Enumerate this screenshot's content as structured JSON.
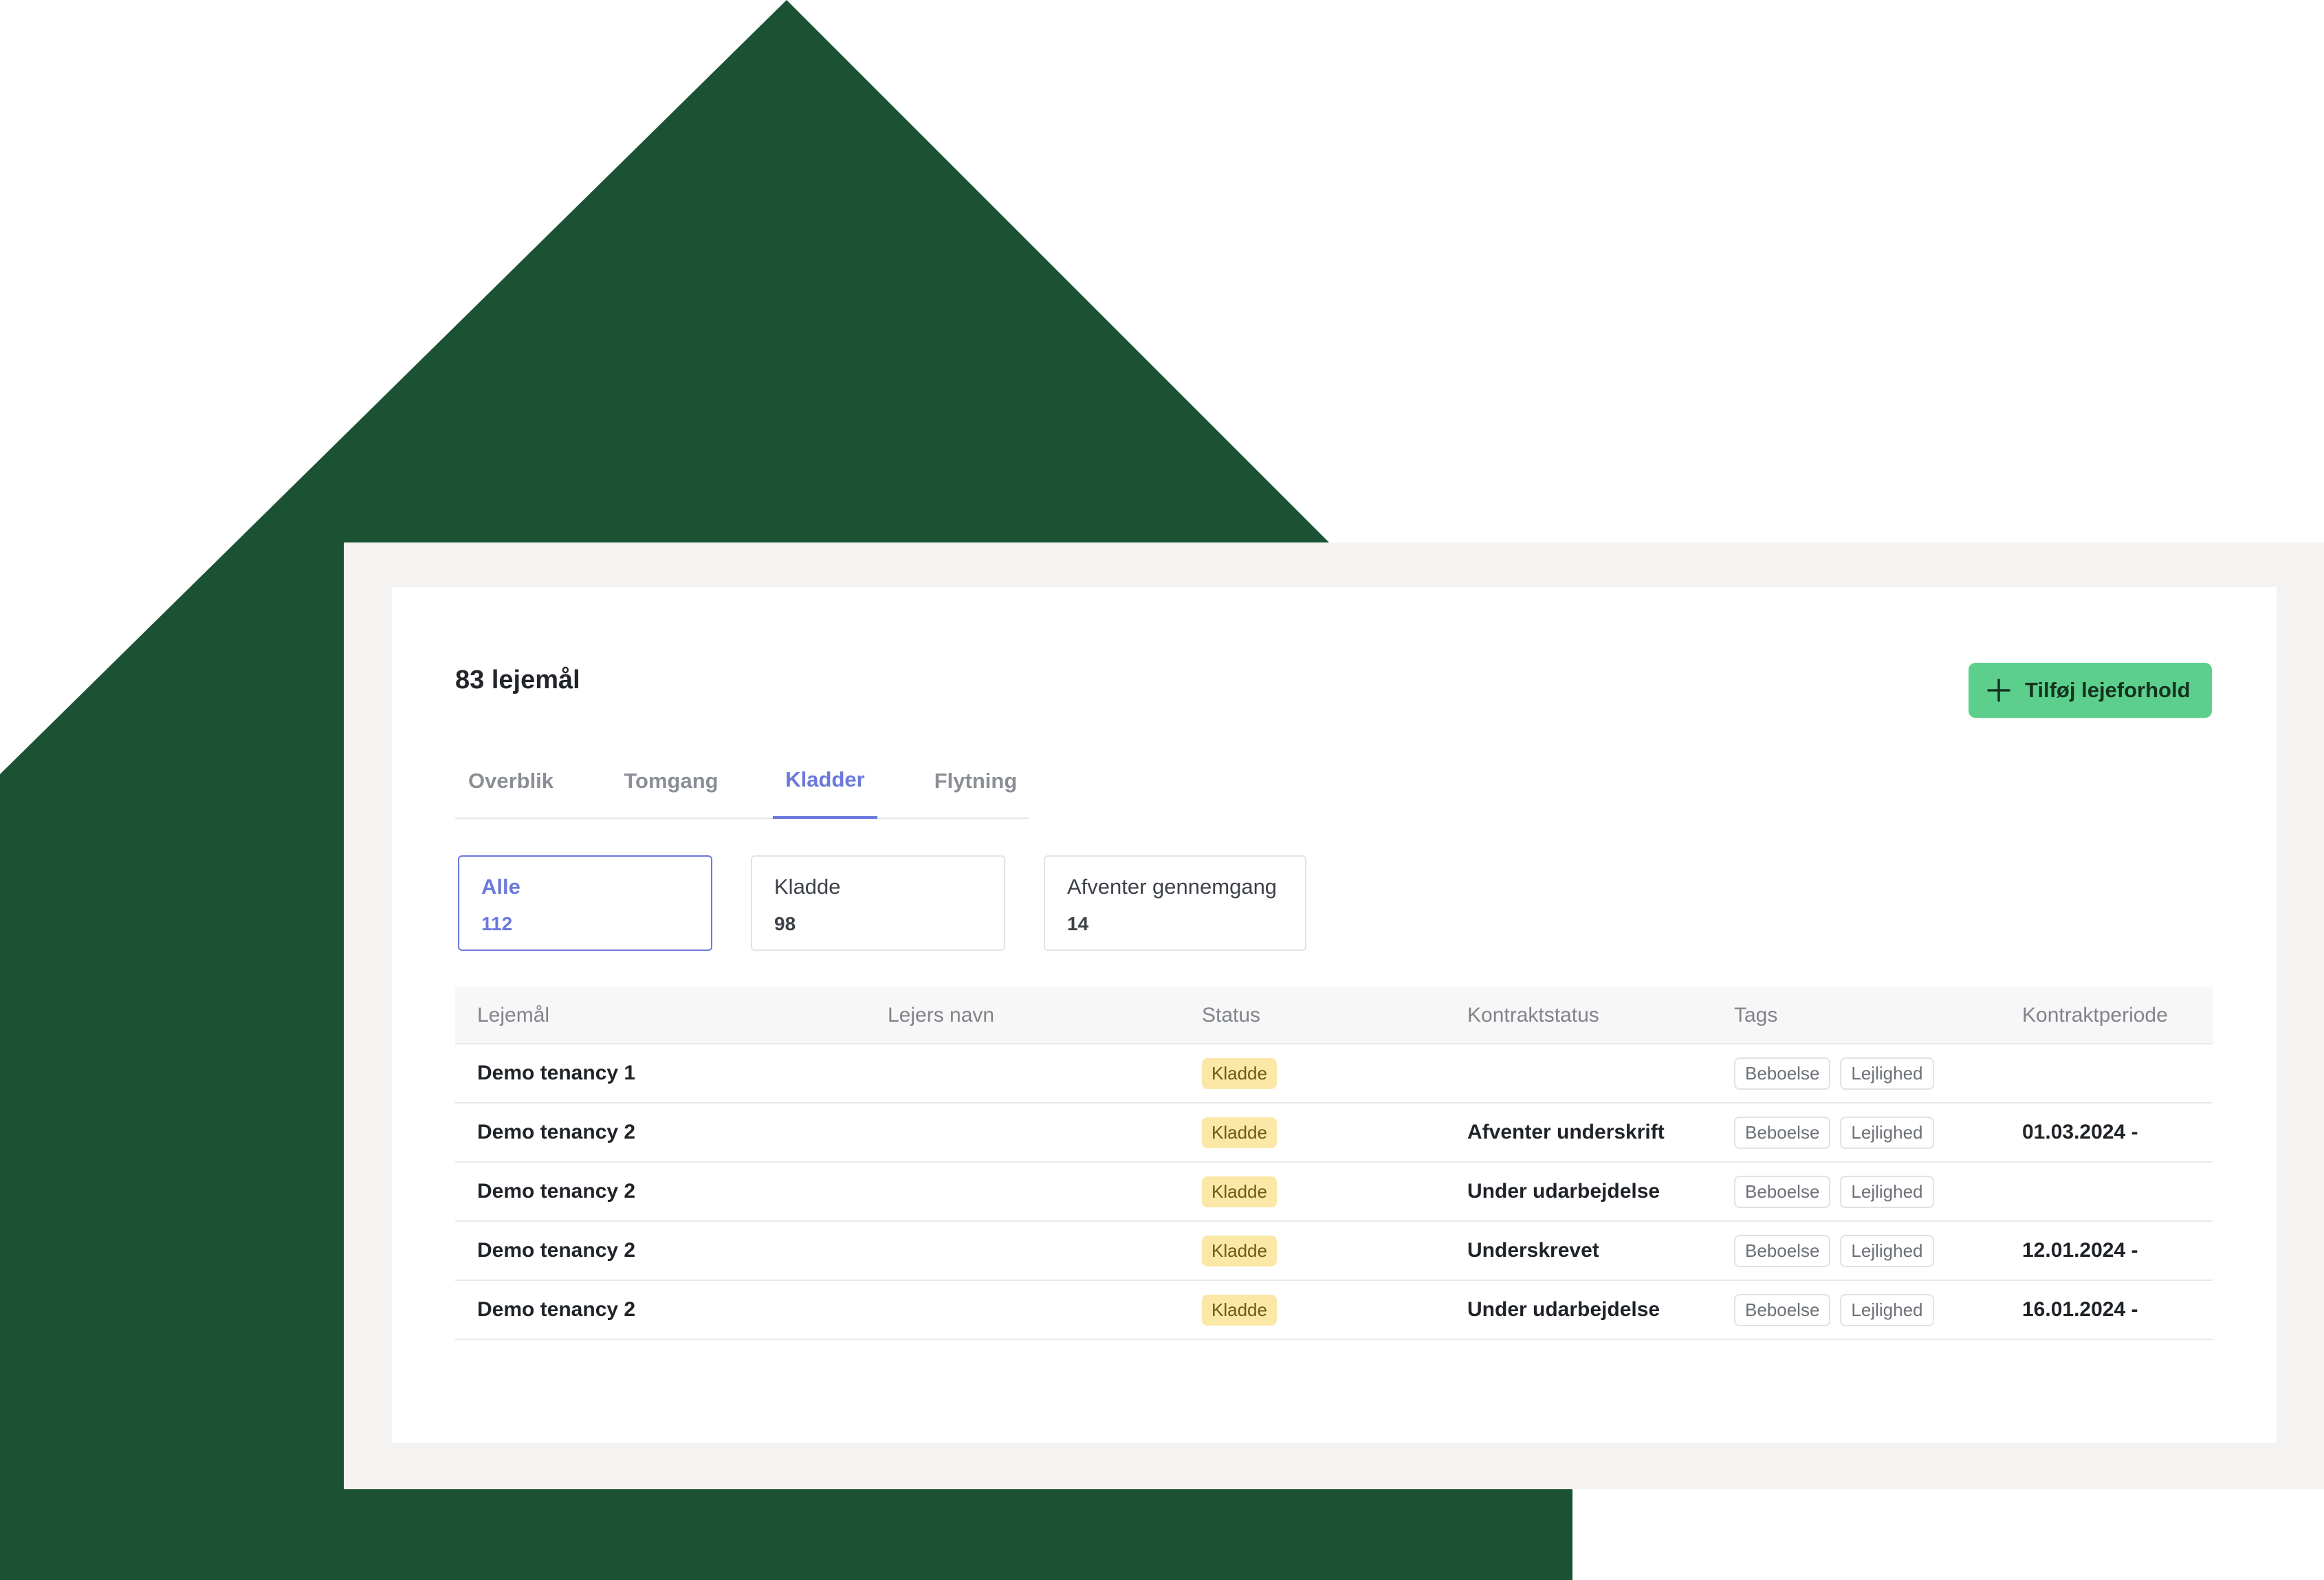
{
  "page": {
    "title": "83 lejemål",
    "add_button_label": "Tilføj lejeforhold"
  },
  "colors": {
    "brand_green": "#1a5233",
    "button_green": "#5ccf8c",
    "accent_blue": "#6b78dc",
    "status_yellow": "#fbe8a6"
  },
  "tabs": [
    {
      "label": "Overblik",
      "active": false
    },
    {
      "label": "Tomgang",
      "active": false
    },
    {
      "label": "Kladder",
      "active": true
    },
    {
      "label": "Flytning",
      "active": false
    }
  ],
  "filters": [
    {
      "label": "Alle",
      "count": "112",
      "active": true
    },
    {
      "label": "Kladde",
      "count": "98",
      "active": false
    },
    {
      "label": "Afventer gennemgang",
      "count": "14",
      "active": false
    }
  ],
  "table": {
    "headers": [
      "Lejemål",
      "Lejers navn",
      "Status",
      "Kontraktstatus",
      "Tags",
      "Kontraktperiode"
    ],
    "rows": [
      {
        "lejemal": "Demo tenancy 1",
        "lejer": "",
        "status": "Kladde",
        "kontraktstatus": "",
        "tags": [
          "Beboelse",
          "Lejlighed"
        ],
        "periode": ""
      },
      {
        "lejemal": "Demo tenancy 2",
        "lejer": "",
        "status": "Kladde",
        "kontraktstatus": "Afventer underskrift",
        "tags": [
          "Beboelse",
          "Lejlighed"
        ],
        "periode": "01.03.2024 -"
      },
      {
        "lejemal": "Demo tenancy 2",
        "lejer": "",
        "status": "Kladde",
        "kontraktstatus": "Under udarbejdelse",
        "tags": [
          "Beboelse",
          "Lejlighed"
        ],
        "periode": ""
      },
      {
        "lejemal": "Demo tenancy 2",
        "lejer": "",
        "status": "Kladde",
        "kontraktstatus": "Underskrevet",
        "tags": [
          "Beboelse",
          "Lejlighed"
        ],
        "periode": "12.01.2024 -"
      },
      {
        "lejemal": "Demo tenancy 2",
        "lejer": "",
        "status": "Kladde",
        "kontraktstatus": "Under udarbejdelse",
        "tags": [
          "Beboelse",
          "Lejlighed"
        ],
        "periode": "16.01.2024 -"
      }
    ]
  }
}
